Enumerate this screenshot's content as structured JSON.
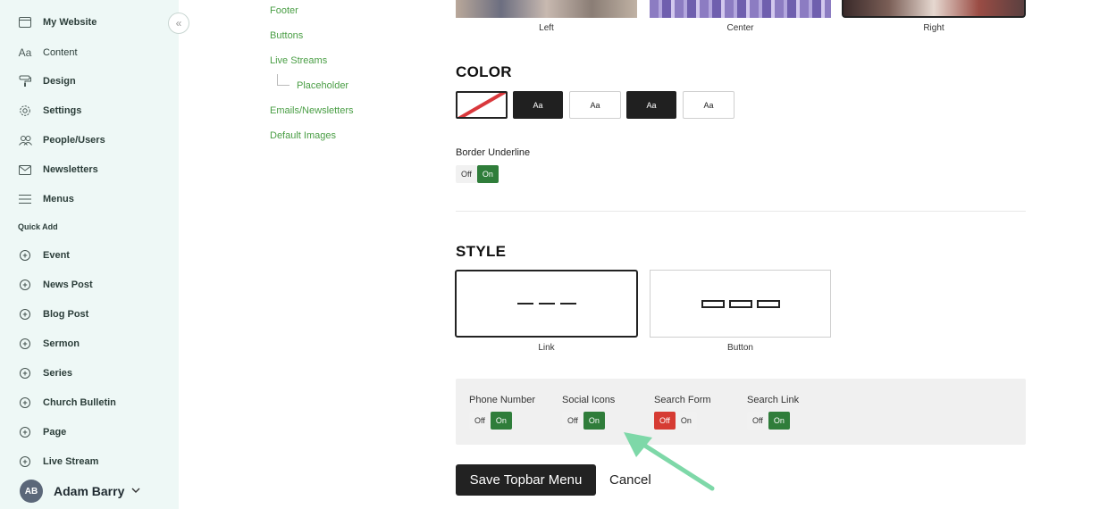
{
  "sidebar": {
    "site_name": "My Website",
    "collapse_glyph": "«",
    "items": [
      {
        "label": "Content",
        "icon": "text-icon"
      },
      {
        "label": "Design",
        "icon": "paint-roller-icon"
      },
      {
        "label": "Settings",
        "icon": "gear-icon"
      },
      {
        "label": "People/Users",
        "icon": "people-icon"
      },
      {
        "label": "Newsletters",
        "icon": "mail-icon"
      },
      {
        "label": "Menus",
        "icon": "menu-icon"
      }
    ],
    "quick_add_heading": "Quick Add",
    "quick_add": [
      "Event",
      "News Post",
      "Blog Post",
      "Sermon",
      "Series",
      "Church Bulletin",
      "Page",
      "Live Stream"
    ],
    "user": {
      "initials": "AB",
      "name": "Adam Barry"
    }
  },
  "subnav": {
    "items": [
      "Footer",
      "Buttons",
      "Live Streams",
      "Emails/Newsletters",
      "Default Images"
    ],
    "child_item": "Placeholder"
  },
  "alignment": {
    "left": "Left",
    "center": "Center",
    "right": "Right"
  },
  "color": {
    "heading": "COLOR",
    "swatch_text": "Aa",
    "border_underline_label": "Border Underline",
    "toggle_off": "Off",
    "toggle_on": "On"
  },
  "style": {
    "heading": "STYLE",
    "link_label": "Link",
    "button_label": "Button"
  },
  "toggles": {
    "phone": {
      "label": "Phone Number",
      "state": "On"
    },
    "social": {
      "label": "Social Icons",
      "state": "On"
    },
    "search_form": {
      "label": "Search Form",
      "state": "Off"
    },
    "search_link": {
      "label": "Search Link",
      "state": "On"
    }
  },
  "actions": {
    "save": "Save Topbar Menu",
    "cancel": "Cancel"
  },
  "colors": {
    "accent_green": "#2f7d3a",
    "link_green": "#4a9e45",
    "off_red": "#d63b33",
    "sidebar_bg": "#eef8f6",
    "arrow": "#7ed8a8"
  }
}
